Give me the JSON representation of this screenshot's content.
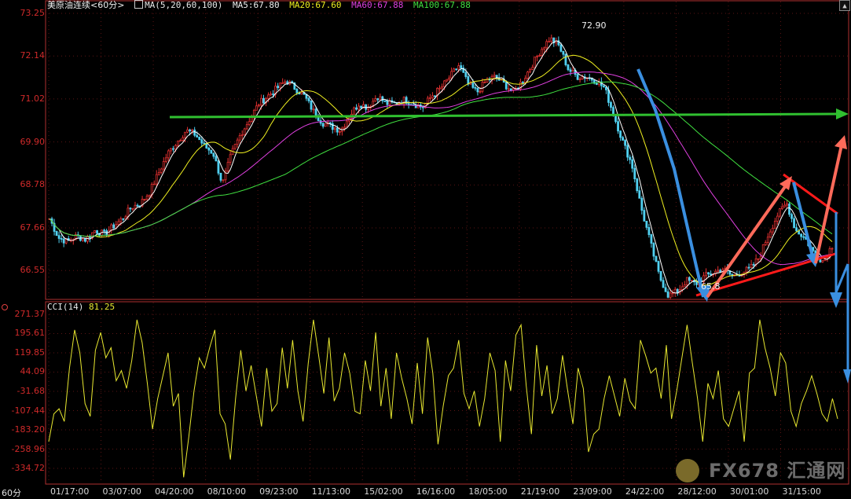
{
  "header": {
    "symbol": "美原油连续",
    "period_tag": "<60分>",
    "ma_params": "MA(5,20,60,100)",
    "ma5": "MA5:67.80",
    "ma20": "MA20:67.60",
    "ma60": "MA60:67.88",
    "ma100": "MA100:67.88"
  },
  "indicator": {
    "label": "CCI(14)",
    "value": "81.25"
  },
  "period_label": "60分",
  "watermark": "FX678 汇通网",
  "colors": {
    "up": "#e03030",
    "down": "#50d0f0",
    "ma5": "#ffffff",
    "ma20": "#f0f020",
    "ma60": "#e040e0",
    "ma100": "#40e040",
    "cci": "#e8e830",
    "axis_text": "#d02a2a"
  },
  "chart_data": [
    {
      "type": "candlestick",
      "title": "美原油连续<60分>",
      "y_ticks": [
        "73.25",
        "72.14",
        "71.02",
        "69.90",
        "68.78",
        "67.66",
        "66.55"
      ],
      "ylim": [
        65.9,
        73.25
      ],
      "x_ticks": [
        "01/17:00",
        "03/07:00",
        "04/20:00",
        "08/10:00",
        "09/23:00",
        "11/13:00",
        "15/02:00",
        "16/16:00",
        "18/05:00",
        "21/19:00",
        "23/09:00",
        "24/22:00",
        "28/12:00",
        "30/01:00",
        "31/15:00"
      ],
      "annotations": {
        "high": "72.90",
        "low": "65.8"
      },
      "close_path": [
        [
          0,
          67.9
        ],
        [
          2,
          67.4
        ],
        [
          4,
          67.3
        ],
        [
          6,
          67.45
        ],
        [
          8,
          67.35
        ],
        [
          10,
          67.6
        ],
        [
          12,
          67.5
        ],
        [
          14,
          67.7
        ],
        [
          16,
          67.9
        ],
        [
          18,
          68.2
        ],
        [
          20,
          68.3
        ],
        [
          22,
          68.6
        ],
        [
          24,
          69.1
        ],
        [
          26,
          69.6
        ],
        [
          28,
          69.9
        ],
        [
          30,
          70.2
        ],
        [
          32,
          70.1
        ],
        [
          34,
          69.8
        ],
        [
          36,
          69.6
        ],
        [
          38,
          68.8
        ],
        [
          40,
          69.6
        ],
        [
          42,
          70.1
        ],
        [
          44,
          70.5
        ],
        [
          46,
          70.9
        ],
        [
          48,
          71.1
        ],
        [
          50,
          71.3
        ],
        [
          52,
          71.5
        ],
        [
          54,
          71.3
        ],
        [
          56,
          71.1
        ],
        [
          58,
          70.7
        ],
        [
          60,
          70.4
        ],
        [
          62,
          70.3
        ],
        [
          64,
          70.2
        ],
        [
          66,
          70.6
        ],
        [
          68,
          70.9
        ],
        [
          70,
          70.8
        ],
        [
          72,
          71.1
        ],
        [
          74,
          70.9
        ],
        [
          76,
          70.9
        ],
        [
          78,
          71.0
        ],
        [
          80,
          70.9
        ],
        [
          82,
          70.8
        ],
        [
          84,
          71.1
        ],
        [
          86,
          71.3
        ],
        [
          88,
          71.6
        ],
        [
          90,
          71.9
        ],
        [
          92,
          71.4
        ],
        [
          94,
          71.2
        ],
        [
          96,
          71.5
        ],
        [
          98,
          71.6
        ],
        [
          100,
          71.4
        ],
        [
          102,
          71.2
        ],
        [
          104,
          71.5
        ],
        [
          106,
          71.9
        ],
        [
          108,
          72.3
        ],
        [
          110,
          72.6
        ],
        [
          112,
          72.4
        ],
        [
          114,
          71.8
        ],
        [
          116,
          71.6
        ],
        [
          118,
          71.6
        ],
        [
          120,
          71.5
        ],
        [
          122,
          71.3
        ],
        [
          124,
          70.6
        ],
        [
          126,
          69.9
        ],
        [
          128,
          69.3
        ],
        [
          130,
          68.2
        ],
        [
          132,
          67.3
        ],
        [
          134,
          66.4
        ],
        [
          136,
          65.9
        ],
        [
          138,
          66.0
        ],
        [
          140,
          66.3
        ],
        [
          142,
          66.2
        ],
        [
          144,
          66.4
        ],
        [
          146,
          66.5
        ],
        [
          148,
          66.6
        ],
        [
          150,
          66.4
        ],
        [
          152,
          66.5
        ],
        [
          154,
          66.6
        ],
        [
          156,
          66.9
        ],
        [
          158,
          67.5
        ],
        [
          160,
          68.0
        ],
        [
          162,
          68.3
        ],
        [
          164,
          67.6
        ],
        [
          166,
          67.4
        ],
        [
          168,
          67.0
        ],
        [
          170,
          66.8
        ],
        [
          172,
          67.2
        ]
      ],
      "series": [
        {
          "name": "MA5",
          "value": 67.8
        },
        {
          "name": "MA20",
          "value": 67.6
        },
        {
          "name": "MA60",
          "value": 67.88
        },
        {
          "name": "MA100",
          "value": 67.88
        }
      ]
    },
    {
      "type": "line",
      "title": "CCI(14)",
      "y_ticks": [
        "271.37",
        "195.61",
        "119.85",
        "44.09",
        "-31.68",
        "-107.44",
        "-183.20",
        "-258.96",
        "-334.72"
      ],
      "ylim": [
        -390,
        300
      ],
      "values": [
        -230,
        -120,
        -100,
        -150,
        60,
        210,
        120,
        -80,
        -130,
        130,
        200,
        100,
        140,
        10,
        50,
        -20,
        90,
        250,
        160,
        0,
        -180,
        -60,
        30,
        120,
        -90,
        -40,
        -370,
        -210,
        -30,
        100,
        60,
        140,
        210,
        -120,
        -160,
        -300,
        -60,
        130,
        -30,
        70,
        -50,
        -170,
        60,
        -110,
        -80,
        140,
        -20,
        170,
        -30,
        -150,
        80,
        250,
        110,
        -40,
        180,
        -70,
        -20,
        120,
        40,
        -110,
        -120,
        90,
        -30,
        200,
        -90,
        60,
        -140,
        120,
        20,
        -60,
        -160,
        80,
        -120,
        180,
        40,
        -240,
        -90,
        30,
        60,
        170,
        -40,
        -100,
        -30,
        -170,
        -60,
        120,
        50,
        -230,
        90,
        -30,
        190,
        230,
        -10,
        -200,
        150,
        -50,
        70,
        -120,
        -60,
        110,
        -30,
        -160,
        60,
        -20,
        -270,
        -200,
        -180,
        -60,
        30,
        -50,
        -130,
        20,
        -70,
        -100,
        170,
        110,
        40,
        60,
        -60,
        150,
        -140,
        -30,
        100,
        230,
        80,
        -60,
        -230,
        0,
        -60,
        50,
        -140,
        -170,
        -100,
        -30,
        -230,
        40,
        60,
        250,
        140,
        60,
        -50,
        120,
        80,
        -110,
        -170,
        -80,
        -30,
        30,
        -40,
        -120,
        -150,
        -60,
        -140
      ]
    }
  ]
}
